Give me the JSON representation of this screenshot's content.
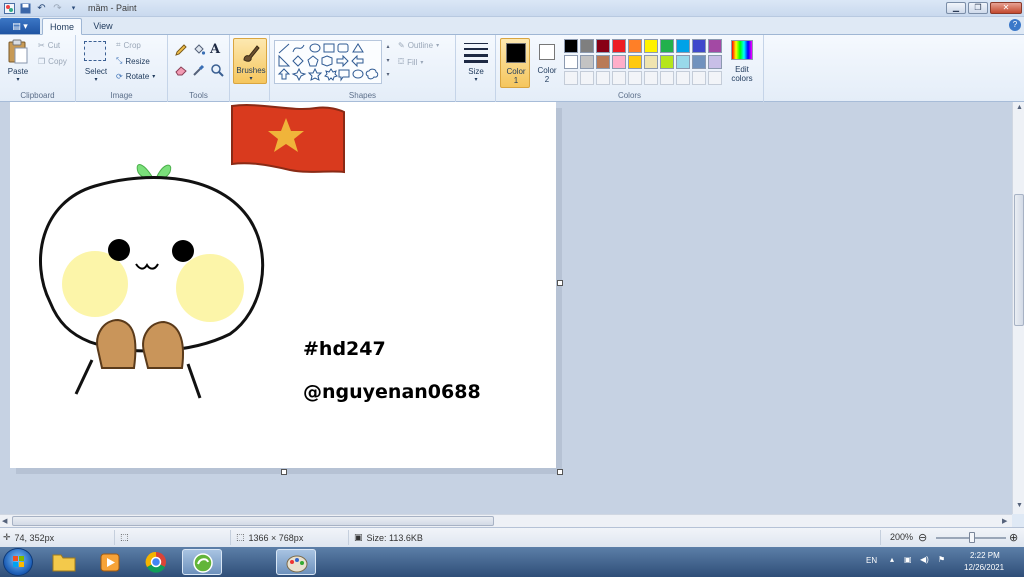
{
  "window": {
    "title": "mầm - Paint"
  },
  "tabs": {
    "file_icon": "▤ ▾",
    "home": "Home",
    "view": "View"
  },
  "ribbon": {
    "clipboard": {
      "label": "Clipboard",
      "paste": "Paste",
      "cut": "Cut",
      "copy": "Copy"
    },
    "image": {
      "label": "Image",
      "select": "Select",
      "crop": "Crop",
      "resize": "Resize",
      "rotate": "Rotate"
    },
    "tools": {
      "label": "Tools"
    },
    "brushes": {
      "label": "Brushes"
    },
    "shapes": {
      "label": "Shapes",
      "outline": "Outline",
      "fill": "Fill"
    },
    "size": {
      "label": "Size"
    },
    "colors": {
      "label": "Colors",
      "color1_line1": "Color",
      "color1_line2": "1",
      "color2_line1": "Color",
      "color2_line2": "2",
      "edit_line1": "Edit",
      "edit_line2": "colors",
      "color1": "#000000",
      "color2": "#ffffff",
      "row1": [
        "#000000",
        "#7f7f7f",
        "#880015",
        "#ed1c24",
        "#ff7f27",
        "#fff200",
        "#22b14c",
        "#00a2e8",
        "#3f48cc",
        "#a349a4"
      ],
      "row2": [
        "#ffffff",
        "#c3c3c3",
        "#b97a57",
        "#ffaec9",
        "#ffc90e",
        "#efe4b0",
        "#b5e61d",
        "#99d9ea",
        "#7092be",
        "#c8bfe7"
      ]
    }
  },
  "canvas": {
    "text_hashtag": "#hd247",
    "text_handle": "@nguyenan0688"
  },
  "status": {
    "cursor_pos": "74, 352px",
    "dimensions": "1366 × 768px",
    "size": "Size: 113.6KB",
    "zoom": "200%"
  },
  "taskbar": {
    "lang": "EN",
    "time": "2:22 PM",
    "date": "12/26/2021"
  }
}
